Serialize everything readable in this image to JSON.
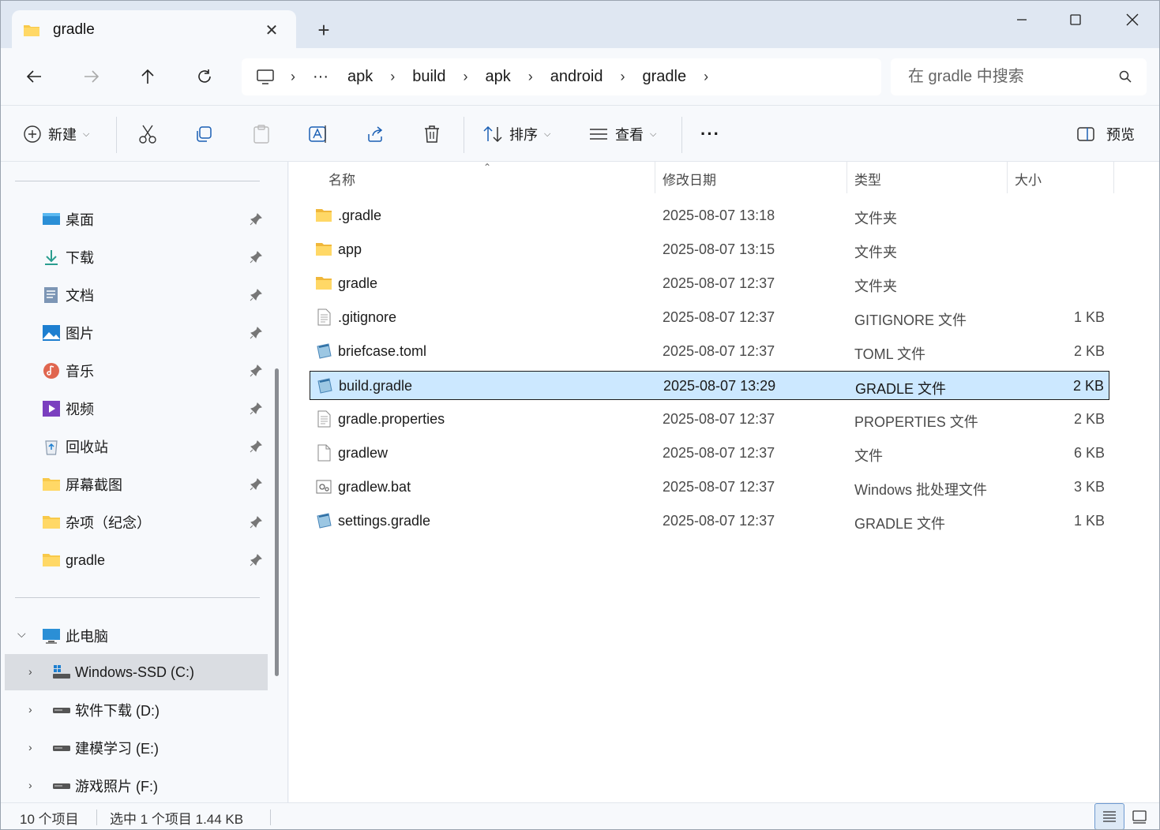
{
  "tab": {
    "title": "gradle",
    "close_glyph": "✕",
    "new_tab_glyph": "+"
  },
  "breadcrumbs": [
    "apk",
    "build",
    "apk",
    "android",
    "gradle"
  ],
  "breadcrumb_overflow": "···",
  "search": {
    "placeholder": "在 gradle 中搜索"
  },
  "toolbar": {
    "new_label": "新建",
    "sort_label": "排序",
    "view_label": "查看",
    "more_label": "···",
    "preview_label": "预览"
  },
  "sidebar": {
    "quick_access": [
      {
        "label": "桌面",
        "icon": "desktop-icon"
      },
      {
        "label": "下载",
        "icon": "download-icon"
      },
      {
        "label": "文档",
        "icon": "document-icon"
      },
      {
        "label": "图片",
        "icon": "pictures-icon"
      },
      {
        "label": "音乐",
        "icon": "music-icon"
      },
      {
        "label": "视频",
        "icon": "video-icon"
      },
      {
        "label": "回收站",
        "icon": "recycle-bin-icon"
      },
      {
        "label": "屏幕截图",
        "icon": "folder-icon"
      },
      {
        "label": "杂项（纪念）",
        "icon": "folder-icon"
      },
      {
        "label": "gradle",
        "icon": "folder-icon"
      }
    ],
    "this_pc": "此电脑",
    "drives": [
      {
        "label": "Windows-SSD (C:)",
        "selected": true
      },
      {
        "label": "软件下载 (D:)",
        "selected": false
      },
      {
        "label": "建模学习 (E:)",
        "selected": false
      },
      {
        "label": "游戏照片 (F:)",
        "selected": false
      }
    ]
  },
  "columns": {
    "name": "名称",
    "modified": "修改日期",
    "type": "类型",
    "size": "大小"
  },
  "files": [
    {
      "name": ".gradle",
      "modified": "2025-08-07 13:18",
      "type": "文件夹",
      "size": "",
      "icon": "folder-icon"
    },
    {
      "name": "app",
      "modified": "2025-08-07 13:15",
      "type": "文件夹",
      "size": "",
      "icon": "folder-icon"
    },
    {
      "name": "gradle",
      "modified": "2025-08-07 12:37",
      "type": "文件夹",
      "size": "",
      "icon": "folder-icon"
    },
    {
      "name": ".gitignore",
      "modified": "2025-08-07 12:37",
      "type": "GITIGNORE 文件",
      "size": "1 KB",
      "icon": "text-file-icon"
    },
    {
      "name": "briefcase.toml",
      "modified": "2025-08-07 12:37",
      "type": "TOML 文件",
      "size": "2 KB",
      "icon": "notepad-file-icon"
    },
    {
      "name": "build.gradle",
      "modified": "2025-08-07 13:29",
      "type": "GRADLE 文件",
      "size": "2 KB",
      "icon": "notepad-file-icon",
      "selected": true
    },
    {
      "name": "gradle.properties",
      "modified": "2025-08-07 12:37",
      "type": "PROPERTIES 文件",
      "size": "2 KB",
      "icon": "text-file-icon"
    },
    {
      "name": "gradlew",
      "modified": "2025-08-07 12:37",
      "type": "文件",
      "size": "6 KB",
      "icon": "blank-file-icon"
    },
    {
      "name": "gradlew.bat",
      "modified": "2025-08-07 12:37",
      "type": "Windows 批处理文件",
      "size": "3 KB",
      "icon": "batch-file-icon"
    },
    {
      "name": "settings.gradle",
      "modified": "2025-08-07 12:37",
      "type": "GRADLE 文件",
      "size": "1 KB",
      "icon": "notepad-file-icon"
    }
  ],
  "status": {
    "item_count": "10 个项目",
    "selection": "选中 1 个项目  1.44 KB"
  },
  "colors": {
    "selection_bg": "#cce8ff",
    "folder_yellow": "#f8c94a",
    "accent": "#0067c0"
  }
}
